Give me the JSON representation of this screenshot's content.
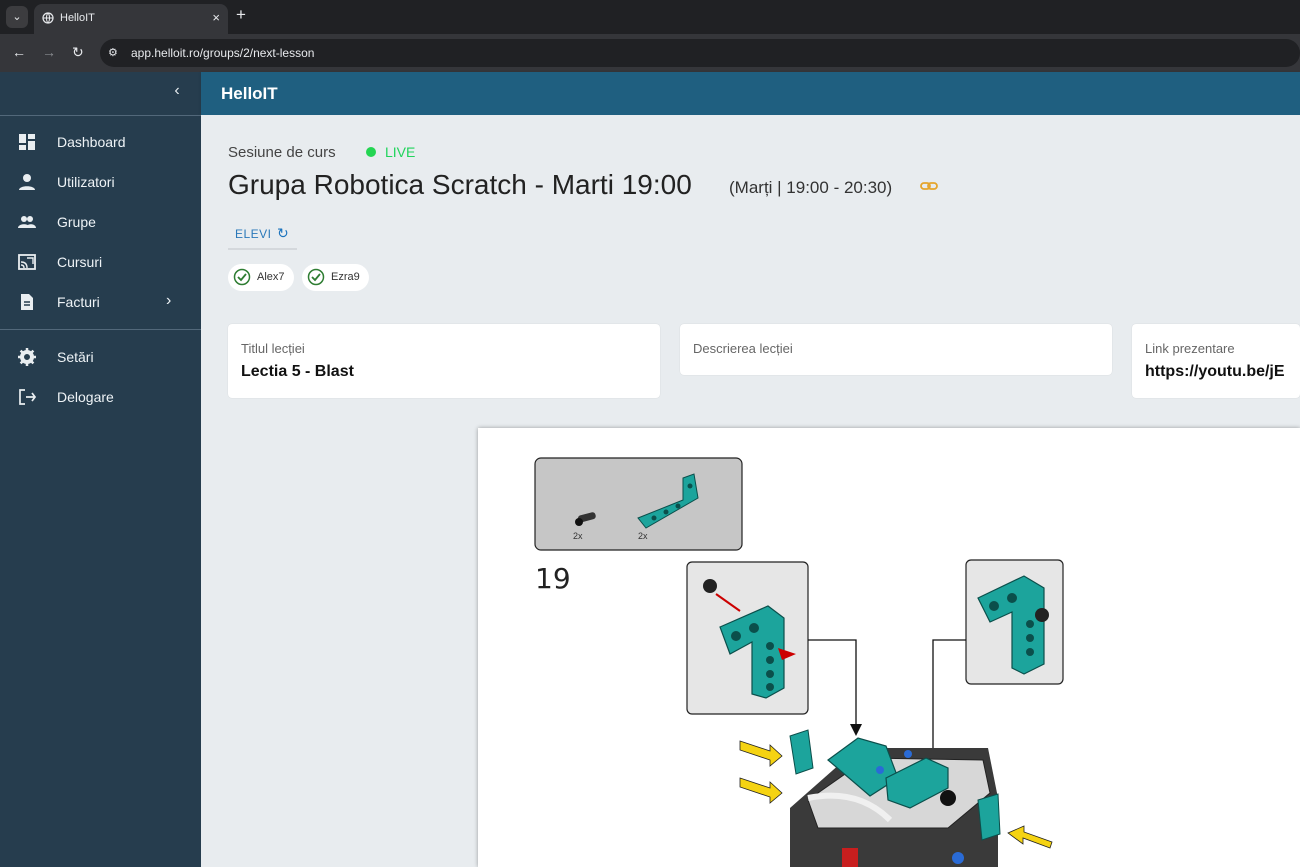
{
  "browser": {
    "tab_title": "HelloIT",
    "new_tab": "+",
    "close_tab": "×",
    "url": "app.helloit.ro/groups/2/next-lesson"
  },
  "app": {
    "brand": "HelloIT"
  },
  "sidebar": {
    "items": [
      {
        "label": "Dashboard",
        "icon": "dashboard-icon"
      },
      {
        "label": "Utilizatori",
        "icon": "user-icon"
      },
      {
        "label": "Grupe",
        "icon": "group-icon"
      },
      {
        "label": "Cursuri",
        "icon": "cast-icon"
      },
      {
        "label": "Facturi",
        "icon": "invoice-icon"
      },
      {
        "label": "Setări",
        "icon": "settings-icon"
      },
      {
        "label": "Delogare",
        "icon": "logout-icon"
      }
    ]
  },
  "session": {
    "label": "Sesiune de curs",
    "status": "LIVE",
    "title": "Grupa Robotica Scratch - Marti 19:00",
    "schedule": "(Marți | 19:00 - 20:30)",
    "students_tab": "ELEVI",
    "students": [
      "Alex7",
      "Ezra9"
    ]
  },
  "lesson": {
    "title_label": "Titlul lecției",
    "title_value": "Lectia 5 - Blast",
    "description_label": "Descrierea lecției",
    "presentation_label": "Link prezentare",
    "presentation_value": "https://youtu.be/jE"
  },
  "slide": {
    "step_number": "19",
    "parts_counts": [
      "2x",
      "2x"
    ]
  },
  "colors": {
    "sidebar": "#263d4e",
    "appbar": "#1f5f80",
    "live": "#24d552",
    "teal_piece": "#1ca49c"
  }
}
